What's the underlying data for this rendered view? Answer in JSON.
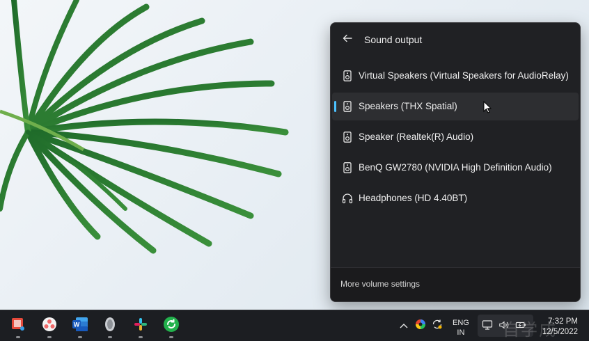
{
  "flyout": {
    "title": "Sound output",
    "back_icon": "back-arrow-icon",
    "devices": [
      {
        "label": "Virtual Speakers (Virtual Speakers for AudioRelay)",
        "icon": "speaker-icon",
        "selected": false
      },
      {
        "label": "Speakers (THX Spatial)",
        "icon": "speaker-icon",
        "selected": true
      },
      {
        "label": "Speaker (Realtek(R) Audio)",
        "icon": "speaker-icon",
        "selected": false
      },
      {
        "label": "BenQ GW2780 (NVIDIA High Definition Audio)",
        "icon": "speaker-icon",
        "selected": false
      },
      {
        "label": "Headphones (HD 4.40BT)",
        "icon": "headphones-icon",
        "selected": false
      }
    ],
    "more_settings": "More volume settings",
    "accent_color": "#4cc2ff"
  },
  "taskbar": {
    "apps": [
      {
        "name": "snipping-tool-icon"
      },
      {
        "name": "asana-icon"
      },
      {
        "name": "word-icon"
      },
      {
        "name": "speaker-app-icon"
      },
      {
        "name": "slack-icon"
      },
      {
        "name": "green-app-icon"
      }
    ],
    "tray": {
      "lang_line1": "ENG",
      "lang_line2": "IN",
      "time": "7:32 PM",
      "date": "12/5/2022"
    },
    "watermark": "自学成"
  }
}
